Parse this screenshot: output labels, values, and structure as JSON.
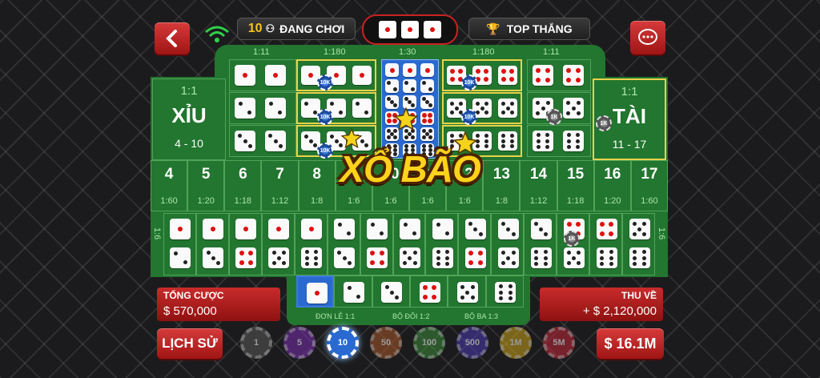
{
  "topbar": {
    "players_count": "10",
    "players_label": "ĐANG CHƠI",
    "top_label": "TOP THẮNG"
  },
  "table": {
    "xiu": {
      "ratio": "1:1",
      "label": "XỈU",
      "range": "4 - 10"
    },
    "tai": {
      "ratio": "1:1",
      "label": "TÀI",
      "range": "11 - 17"
    },
    "top_ratios": [
      "1:11",
      "1:180",
      "1:30",
      "1:180",
      "1:11"
    ],
    "numbers": [
      {
        "n": "4",
        "r": "1:60"
      },
      {
        "n": "5",
        "r": "1:20"
      },
      {
        "n": "6",
        "r": "1:18"
      },
      {
        "n": "7",
        "r": "1:12"
      },
      {
        "n": "8",
        "r": "1:8"
      },
      {
        "n": "9",
        "r": "1:6"
      },
      {
        "n": "10",
        "r": "1:6"
      },
      {
        "n": "11",
        "r": "1:6"
      },
      {
        "n": "12",
        "r": "1:6"
      },
      {
        "n": "13",
        "r": "1:8"
      },
      {
        "n": "14",
        "r": "1:12"
      },
      {
        "n": "15",
        "r": "1:18"
      },
      {
        "n": "16",
        "r": "1:20"
      },
      {
        "n": "17",
        "r": "1:60"
      }
    ],
    "side_ratio_left": "1:6",
    "side_ratio_right": "1:6",
    "chip_labels": {
      "bet": "10K",
      "other": "1K"
    }
  },
  "banner": {
    "text": "XỔ BÃO"
  },
  "bottom": {
    "total_bet_label": "TỔNG CƯỢC",
    "total_bet_value": "$ 570,000",
    "return_label": "THU VỀ",
    "return_value": "+ $ 2,120,000",
    "singles_label": "ĐƠN LẺ 1:1",
    "pairs_label": "BỘ ĐÔI 1:2",
    "triples_label": "BỘ BA 1:3",
    "history_label": "LỊCH SỬ",
    "balance": "$ 16.1M",
    "chips": [
      "1",
      "5",
      "10",
      "50",
      "100",
      "500",
      "1M",
      "5M"
    ],
    "selected_chip": "10"
  },
  "colors": {
    "felt": "#22762f",
    "accent_red": "#c92b2b",
    "gold": "#f5c518"
  }
}
